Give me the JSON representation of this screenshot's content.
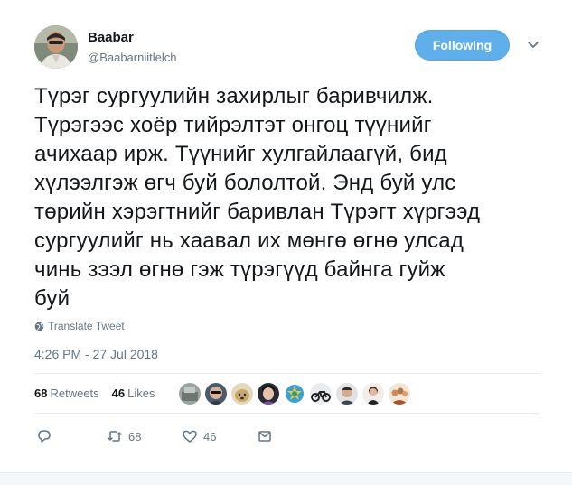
{
  "author": {
    "name": "Baabar",
    "handle": "@Baabarniitlelch"
  },
  "follow_button": {
    "label": "Following",
    "color": "#5fb0ea"
  },
  "tweet": {
    "lines": [
      "Түрэг сургуулийн захирлыг баривчилж.",
      "Түрэгээс хоёр тийрэлтэт онгоц түүнийг",
      "ачихаар ирж. Түүнийг хулгайлаагүй, бид",
      "хүлээлгэж өгч буй бололтой. Энд буй улс",
      "төрийн хэрэгтнийг баривлан Түрэгт хүргээд",
      "сургуулийг нь хаавал их мөнгө өгнө улсад",
      "чинь зээл өгнө гэж түрэгүүд байнга гуйж",
      "буй"
    ],
    "translate_label": "Translate Tweet",
    "timestamp": "4:26 PM - 27 Jul 2018"
  },
  "stats": {
    "retweets_count": "68",
    "retweets_label": "Retweets",
    "likes_count": "46",
    "likes_label": "Likes"
  },
  "likers": [
    {
      "icon": "avatar-stone",
      "color": "#9aa3a0"
    },
    {
      "icon": "avatar-sunglasses",
      "color": "#4b5b6b"
    },
    {
      "icon": "avatar-dog",
      "color": "#c8b48a"
    },
    {
      "icon": "avatar-woman",
      "color": "#2b2b34"
    },
    {
      "icon": "avatar-badge",
      "color": "#3aa0d8"
    },
    {
      "icon": "avatar-motorbike",
      "color": "#e8ecef"
    },
    {
      "icon": "avatar-man",
      "color": "#6d7a82"
    },
    {
      "icon": "avatar-person",
      "color": "#d7c9c0"
    },
    {
      "icon": "avatar-group",
      "color": "#c98a5c"
    }
  ],
  "actions": {
    "reply_icon": "reply-icon",
    "retweet_icon": "retweet-icon",
    "retweet_count": "68",
    "like_icon": "heart-icon",
    "like_count": "46",
    "dm_icon": "envelope-icon"
  },
  "colors": {
    "text": "#14171a",
    "muted": "#657786",
    "accent": "#1da1f2"
  }
}
